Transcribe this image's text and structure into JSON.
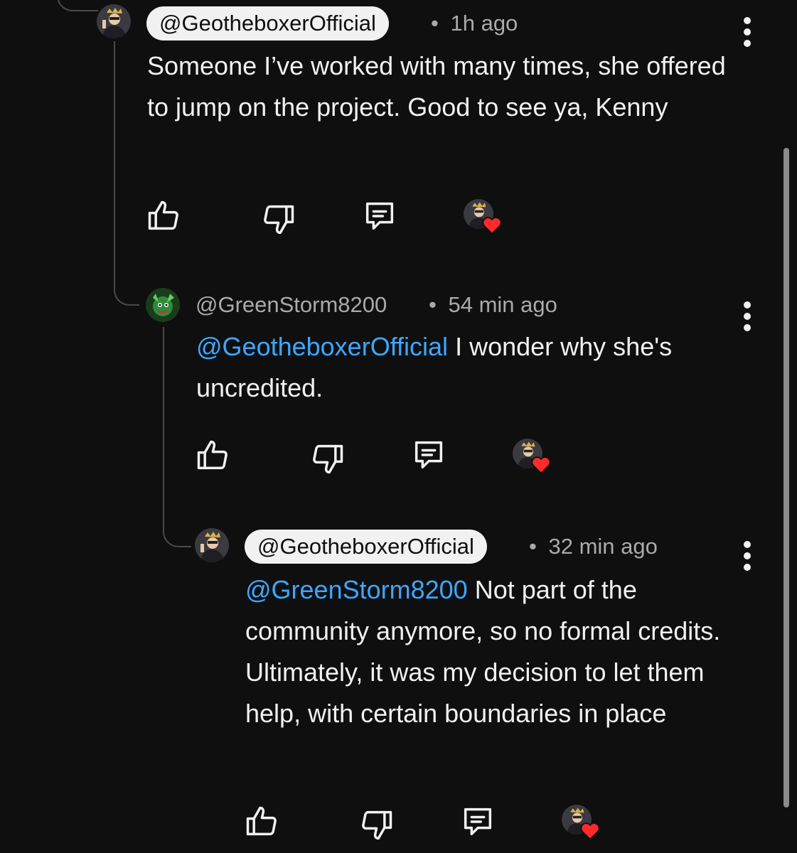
{
  "comments": [
    {
      "author": "@GeotheboxerOfficial",
      "time": "1h ago",
      "text": "Someone I’ve worked with many times, she offered to jump on the project. Good to see ya, Kenny",
      "mention": ""
    },
    {
      "author": "@GreenStorm8200",
      "time": "54 min ago",
      "mention": "@GeotheboxerOfficial",
      "text": "I wonder why she's uncredited."
    },
    {
      "author": "@GeotheboxerOfficial",
      "time": "32 min ago",
      "mention": "@GreenStorm8200",
      "text": "Not part of the community anymore, so no formal credits. Ultimately, it was my decision to let them help, with certain boundaries in place"
    }
  ],
  "separator": "•",
  "icons": {
    "like": "thumbs-up-icon",
    "dislike": "thumbs-down-icon",
    "reply": "reply-comment-icon",
    "creator_heart": "creator-heart-icon",
    "menu": "more-vertical-icon"
  },
  "colors": {
    "background": "#0f0f0f",
    "text": "#f1f1f1",
    "secondary": "#aaaaaa",
    "mention": "#3ea6ff",
    "heart": "#ff2a2a",
    "pill": "#f1f1f1"
  }
}
